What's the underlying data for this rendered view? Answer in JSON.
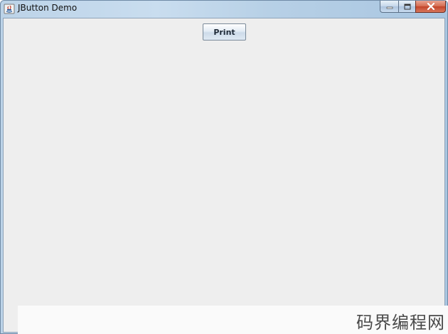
{
  "window": {
    "title": "JButton Demo",
    "controls": {
      "minimize_icon": "minimize-icon",
      "maximize_icon": "maximize-icon",
      "close_icon": "close-icon"
    }
  },
  "content": {
    "print_button_label": "Print"
  },
  "watermark": {
    "text": "码界编程网"
  },
  "colors": {
    "client_background": "#eeeeee",
    "close_button": "#c2442a"
  }
}
